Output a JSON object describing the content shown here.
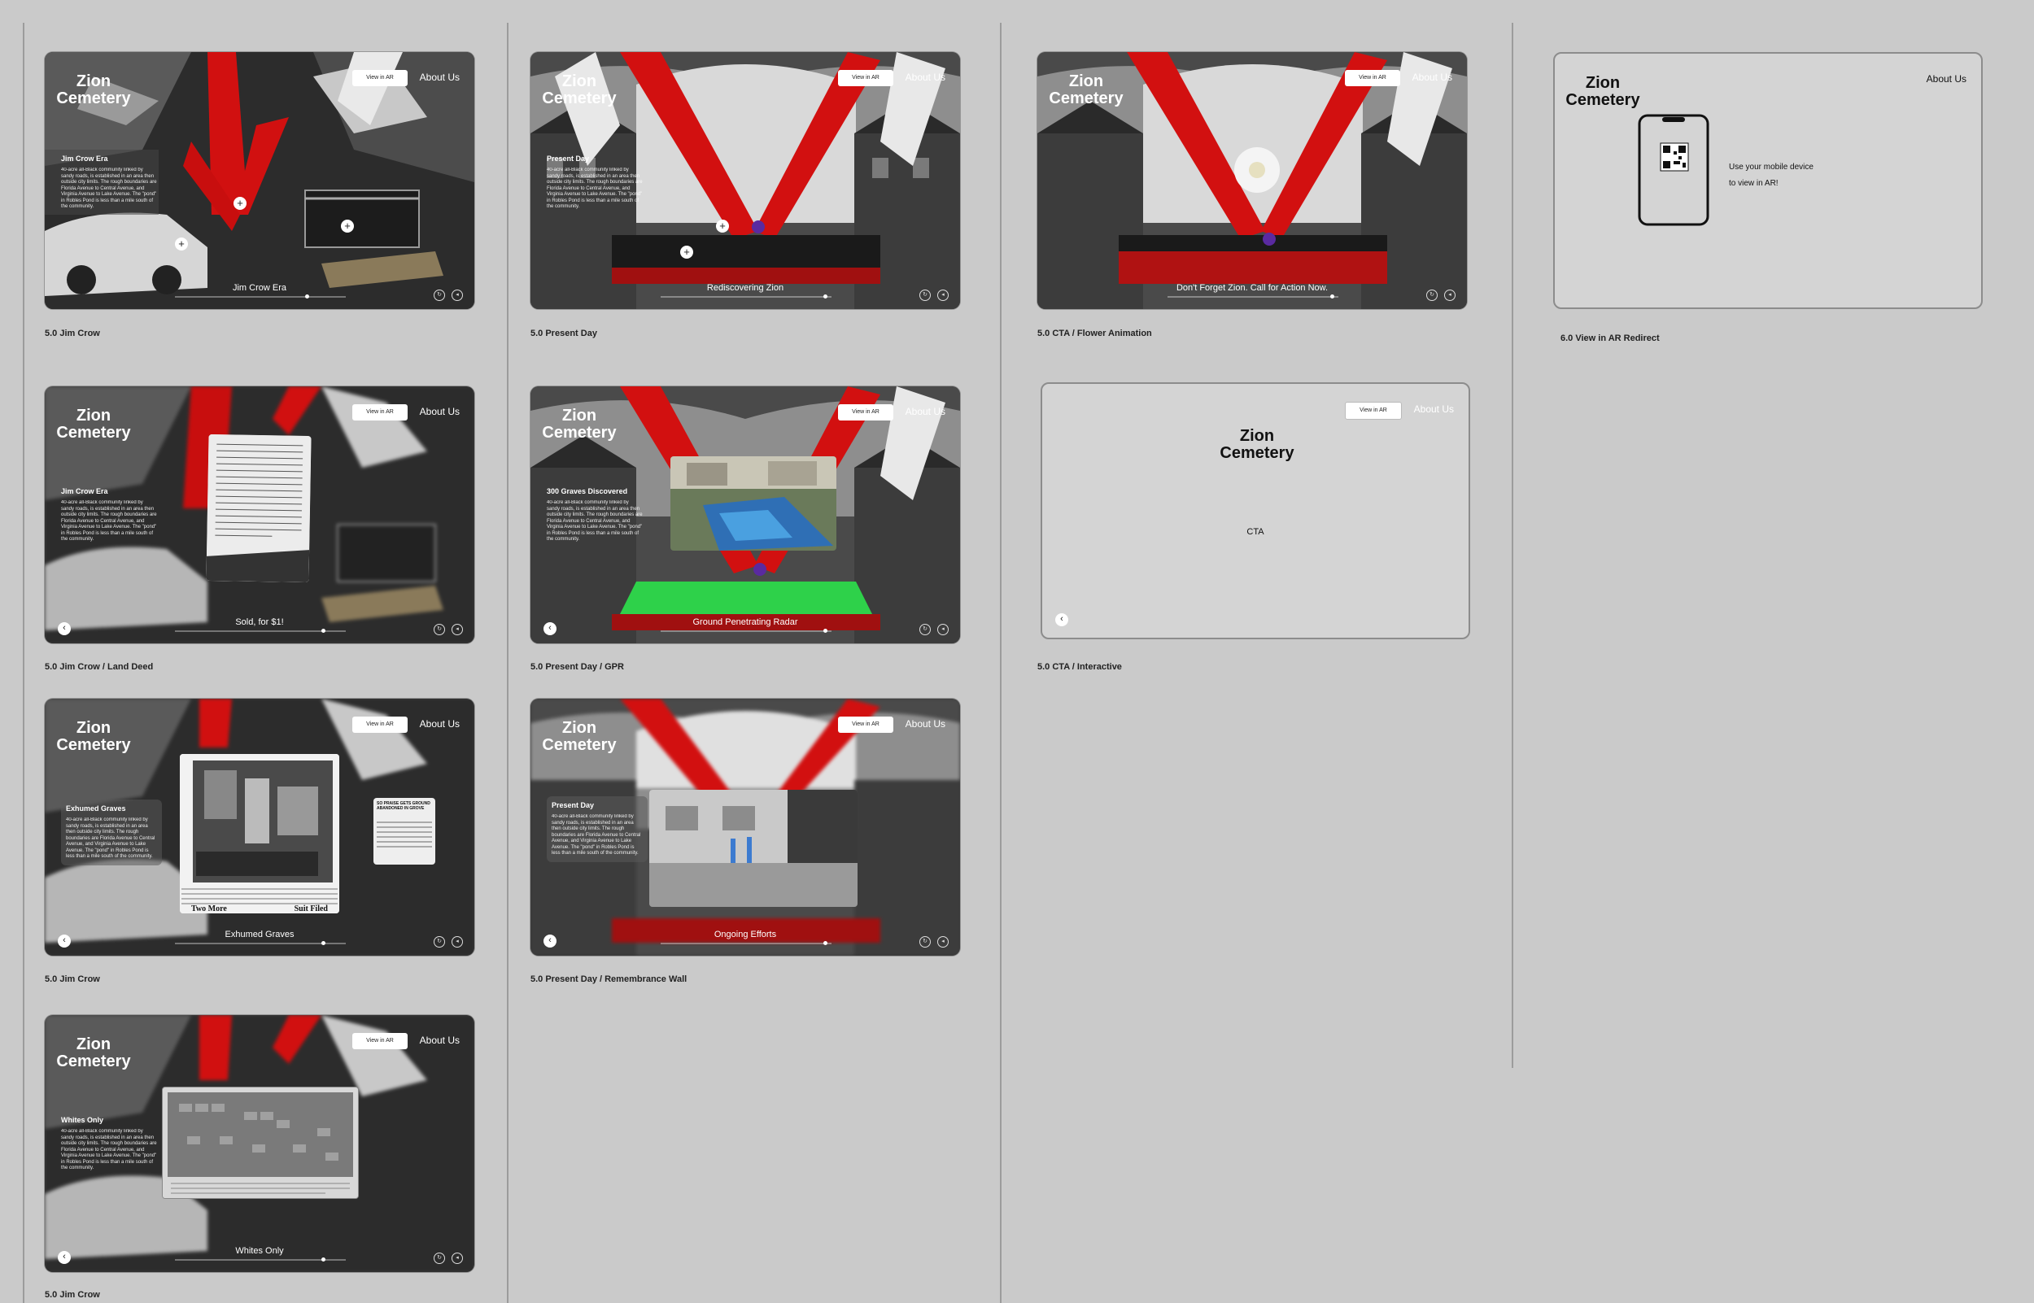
{
  "logo": "Zion\nCemetery",
  "nav": {
    "view_ar": "View in AR",
    "about": "About Us"
  },
  "panel_text": "40-acre all-Black community linked by sandy roads, is established in an area then outside city limits. The rough boundaries are Florida Avenue to Central Avenue, and Virginia Avenue to Lake Avenue. The \"pond\" in Robles Pond is less than a mile south of the community.",
  "frames": [
    {
      "id": "jim-crow",
      "panel_title": "Jim Crow Era",
      "caption": "Jim Crow Era",
      "label": "5.0 Jim Crow"
    },
    {
      "id": "present-day",
      "panel_title": "Present Day",
      "caption": "Rediscovering Zion",
      "label": "5.0 Present Day"
    },
    {
      "id": "cta-flower",
      "caption": "Don't Forget Zion. Call for Action Now.",
      "label": "5.0 CTA / Flower Animation"
    },
    {
      "id": "land-deed",
      "panel_title": "Jim Crow Era",
      "caption": "Sold, for $1!",
      "label": "5.0 Jim Crow / Land Deed"
    },
    {
      "id": "gpr",
      "panel_title": "300 Graves Discovered",
      "caption": "Ground Penetrating Radar",
      "label": "5.0 Present Day / GPR"
    },
    {
      "id": "cta-interactive",
      "center_text": "CTA",
      "label": "5.0 CTA / Interactive"
    },
    {
      "id": "exhumed",
      "panel_title": "Exhumed Graves",
      "caption": "Exhumed Graves",
      "label": "5.0 Jim Crow"
    },
    {
      "id": "remembrance",
      "panel_title": "Present Day",
      "caption": "Ongoing Efforts",
      "label": "5.0 Present Day / Remembrance Wall"
    },
    {
      "id": "whites-only",
      "panel_title": "Whites Only",
      "caption": "Whites Only",
      "label": "5.0 Jim Crow"
    }
  ],
  "ar_redirect": {
    "message_line1": "Use your mobile device",
    "message_line2": "to view in AR!",
    "label": "6.0 View in AR Redirect"
  },
  "newspaper": {
    "headline": "SO PRAISE GETS GROUND ABANDONED IN GROVE",
    "two_more": "Two More",
    "suit_filed": "Suit Filed"
  },
  "colors": {
    "red": "#d21010",
    "bg": "#cacaca",
    "dark": "#2e2e2e"
  }
}
